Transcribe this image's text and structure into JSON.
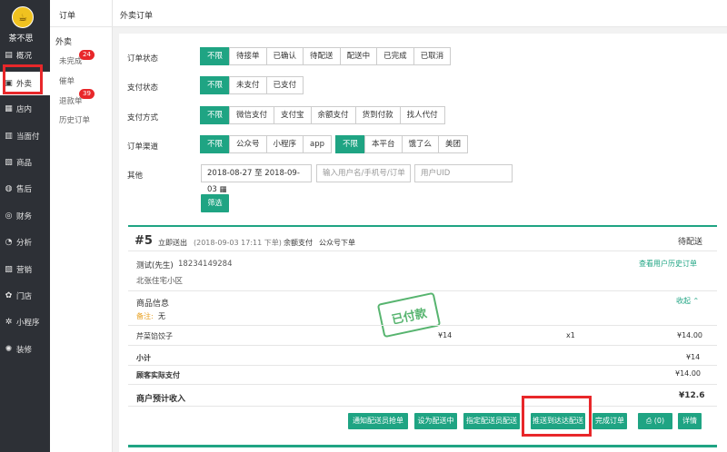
{
  "sidebar": {
    "brand": "茶不思",
    "items": [
      {
        "icon": "dashboard-icon",
        "glyph": "▤",
        "label": "概况"
      },
      {
        "icon": "takeout-icon",
        "glyph": "▣",
        "label": "外卖"
      },
      {
        "icon": "store-icon",
        "glyph": "▦",
        "label": "店内"
      },
      {
        "icon": "pay-icon",
        "glyph": "▥",
        "label": "当面付"
      },
      {
        "icon": "goods-icon",
        "glyph": "▧",
        "label": "商品"
      },
      {
        "icon": "aftersale-icon",
        "glyph": "◍",
        "label": "售后"
      },
      {
        "icon": "finance-icon",
        "glyph": "◎",
        "label": "财务"
      },
      {
        "icon": "analysis-icon",
        "glyph": "◔",
        "label": "分析"
      },
      {
        "icon": "marketing-icon",
        "glyph": "▨",
        "label": "营销"
      },
      {
        "icon": "shop-icon",
        "glyph": "✿",
        "label": "门店"
      },
      {
        "icon": "miniprogram-icon",
        "glyph": "✲",
        "label": "小程序"
      },
      {
        "icon": "decorate-icon",
        "glyph": "✺",
        "label": "装修"
      }
    ]
  },
  "subnav": {
    "title": "订单",
    "section": "外卖",
    "items": [
      {
        "label": "未完成",
        "badge": "24"
      },
      {
        "label": "催单",
        "badge": ""
      },
      {
        "label": "退款单",
        "badge": "39"
      },
      {
        "label": "历史订单",
        "badge": ""
      }
    ]
  },
  "header": {
    "title": "外卖订单"
  },
  "filters": {
    "order_status": {
      "label": "订单状态",
      "options": [
        "不限",
        "待接单",
        "已确认",
        "待配送",
        "配送中",
        "已完成",
        "已取消"
      ]
    },
    "pay_status": {
      "label": "支付状态",
      "options": [
        "不限",
        "未支付",
        "已支付"
      ]
    },
    "pay_method": {
      "label": "支付方式",
      "options": [
        "不限",
        "微信支付",
        "支付宝",
        "余额支付",
        "货到付款",
        "找人代付"
      ]
    },
    "channel": {
      "label": "订单渠道",
      "options_a": [
        "不限",
        "公众号",
        "小程序",
        "app"
      ],
      "options_b": [
        "不限",
        "本平台",
        "饿了么",
        "美团"
      ]
    },
    "other": {
      "label": "其他",
      "date_range": "2018-08-27 至 2018-09-03",
      "user_placeholder": "输入用户名/手机号/订单",
      "uid_placeholder": "用户UID"
    },
    "submit": "筛选"
  },
  "order": {
    "no": "#5",
    "type": "立即送出",
    "time": "(2018-09-03 17:11 下单)",
    "pay": "余额支付",
    "source": "公众号下单",
    "status": "待配送",
    "customer": "测试(先生)",
    "phone": "18234149284",
    "history_link": "查看用户历史订单",
    "address": "北张住宅小区",
    "goods_title": "商品信息",
    "collapse": "收起",
    "remark_label": "备注:",
    "remark": "无",
    "stamp": "已付款",
    "item": {
      "name": "芹菜馅饺子",
      "price": "¥14",
      "qty": "x1",
      "total": "¥14.00"
    },
    "subtotal_label": "小计",
    "subtotal": "¥14",
    "paid_label": "顾客实际支付",
    "paid": "¥14.00",
    "income_label": "商户预计收入",
    "income": "¥12.6",
    "actions": [
      "通知配送员抢单",
      "设为配送中",
      "指定配送员配送",
      "推送到达达配送",
      "完成订单",
      "(0)",
      "详情"
    ]
  }
}
